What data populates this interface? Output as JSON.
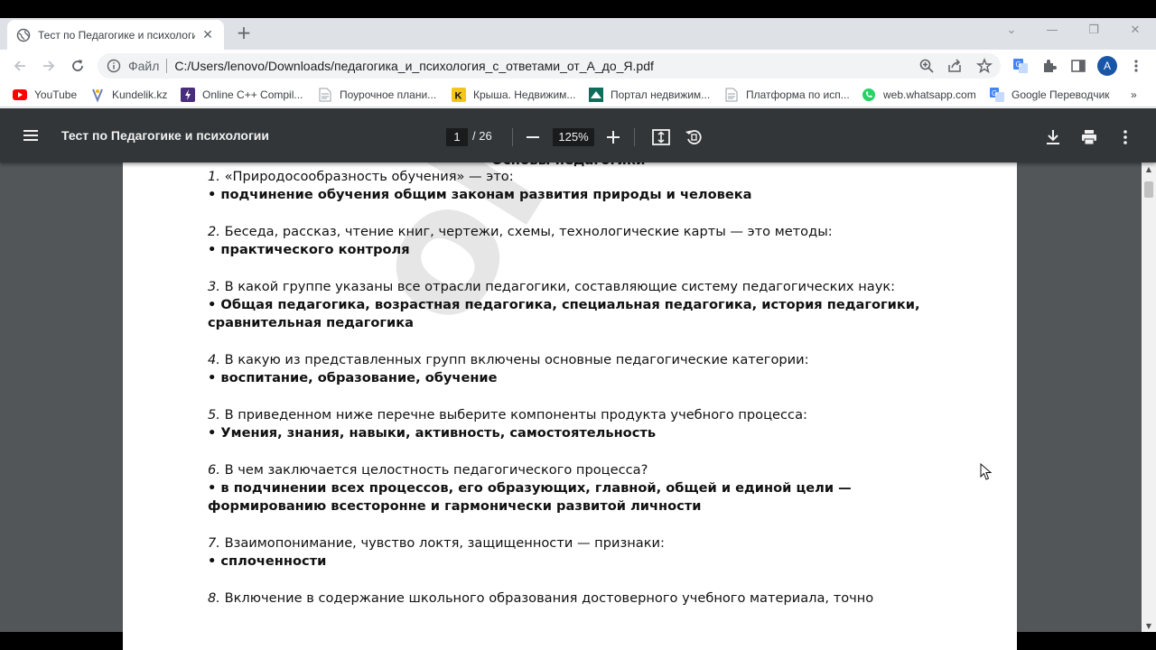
{
  "browser": {
    "tab": {
      "title": "Тест по Педагогике и психологии",
      "close_glyph": "✕"
    },
    "new_tab_glyph": "+",
    "window_controls": [
      "⌄",
      "—",
      "❐",
      "✕"
    ],
    "address": {
      "scheme_label": "Файл",
      "url": "C:/Users/lenovo/Downloads/педагогика_и_психология_с_ответами_от_А_до_Я.pdf"
    },
    "avatar_letter": "A",
    "bookmarks": [
      {
        "label": "YouTube",
        "icon": "youtube-icon"
      },
      {
        "label": "Kundelik.kz",
        "icon": "kundelik-icon"
      },
      {
        "label": "Online C++ Compil...",
        "icon": "compiler-icon"
      },
      {
        "label": "Поурочное плани...",
        "icon": "page-icon"
      },
      {
        "label": "Крыша. Недвижим...",
        "icon": "krisha-icon"
      },
      {
        "label": "Портал недвижим...",
        "icon": "portal-icon"
      },
      {
        "label": "Платформа по исп...",
        "icon": "page-icon"
      },
      {
        "label": "web.whatsapp.com",
        "icon": "whatsapp-icon"
      },
      {
        "label": "Google Переводчик",
        "icon": "translate-icon"
      }
    ],
    "bookmarks_overflow": "»"
  },
  "pdf": {
    "title": "Тест по Педагогике и психологии",
    "current_page": "1",
    "total_pages": "/ 26",
    "zoom": "125%",
    "heading": "Основы педагогики",
    "watermark": "oltest.kz",
    "questions": [
      {
        "num": "1.",
        "q": "«Природосообразность обучения» — это:",
        "a": "• подчинение обучения общим законам развития природы и человека"
      },
      {
        "num": "2.",
        "q": "Беседа, рассказ, чтение книг, чертежи, схемы, технологические карты — это методы:",
        "a": "• практического контроля"
      },
      {
        "num": "3.",
        "q": "В какой группе указаны все отрасли педагогики, составляющие систему педагогических наук:",
        "a": "• Общая педагогика, возрастная педагогика, специальная педагогика, история педагогики, сравнительная педагогика"
      },
      {
        "num": "4.",
        "q": "В какую из представленных групп включены основные педагогические категории:",
        "a": "• воспитание, образование, обучение"
      },
      {
        "num": "5.",
        "q": "В приведенном ниже перечне выберите компоненты продукта учебного процесса:",
        "a": "• Умения, знания, навыки, активность, самостоятельность"
      },
      {
        "num": "6.",
        "q": "В чем заключается целостность педагогического процесса?",
        "a": "• в подчинении всех процессов, его образующих, главной, общей и единой цели — формированию всесторонне и гармонически развитой личности"
      },
      {
        "num": "7.",
        "q": "Взаимопонимание, чувство локтя, защищенности — признаки:",
        "a": "• сплоченности"
      },
      {
        "num": "8.",
        "q": "Включение в содержание школьного образования достоверного учебного материала, точно",
        "a": ""
      }
    ]
  },
  "colors": {
    "pdf_toolbar": "#323639",
    "viewer_bg": "#525659",
    "tabstrip": "#dee1e6",
    "avatar": "#1a56a8"
  }
}
